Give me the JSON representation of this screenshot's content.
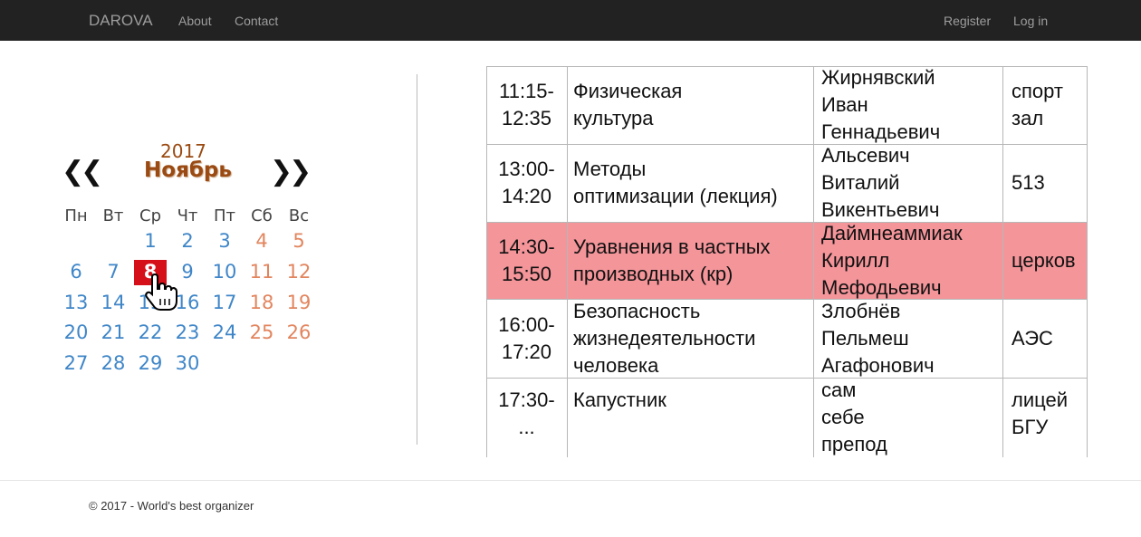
{
  "navbar": {
    "brand": "DAROVA",
    "links": [
      "About",
      "Contact"
    ],
    "right_links": [
      "Register",
      "Log in"
    ]
  },
  "calendar": {
    "year": "2017",
    "month": "Ноябрь",
    "prev_label": "❮❮",
    "next_label": "❯❯",
    "weekdays": [
      "Пн",
      "Вт",
      "Ср",
      "Чт",
      "Пт",
      "Сб",
      "Вс"
    ],
    "weeks": [
      [
        "",
        "",
        "1",
        "2",
        "3",
        "4",
        "5"
      ],
      [
        "6",
        "7",
        "8",
        "9",
        "10",
        "11",
        "12"
      ],
      [
        "13",
        "14",
        "15",
        "16",
        "17",
        "18",
        "19"
      ],
      [
        "20",
        "21",
        "22",
        "23",
        "24",
        "25",
        "26"
      ],
      [
        "27",
        "28",
        "29",
        "30",
        "",
        "",
        ""
      ]
    ],
    "selected_day": "8",
    "colors": {
      "weekday": "#3f86c8",
      "weekend": "#e2855e",
      "selected_bg": "#d61018",
      "header": "#9a4a12"
    }
  },
  "schedule": {
    "highlight_color": "#f4959a",
    "rows": [
      {
        "time": [
          "11:15-",
          "12:35"
        ],
        "subject": [
          "Физическая",
          "культура"
        ],
        "teacher": [
          "Жирнявский",
          "Иван",
          "Геннадьевич"
        ],
        "room": [
          "спорт",
          "зал"
        ],
        "highlight": false
      },
      {
        "time": [
          "13:00-",
          "14:20"
        ],
        "subject": [
          "Методы",
          "оптимизации (лекция)"
        ],
        "teacher": [
          "Альсевич",
          "Виталий",
          "Викентьевич"
        ],
        "room": [
          "513"
        ],
        "highlight": false
      },
      {
        "time": [
          "14:30-",
          "15:50"
        ],
        "subject": [
          "Уравнения в частных",
          "производных (кр)"
        ],
        "teacher": [
          "Даймнеаммиак",
          "Кирилл",
          "Мефодьевич"
        ],
        "room": [
          "церков"
        ],
        "highlight": true
      },
      {
        "time": [
          "16:00-",
          "17:20"
        ],
        "subject": [
          "Безопасность",
          "жизнедеятельности",
          "человека"
        ],
        "teacher": [
          "Злобнёв",
          "Пельмеш",
          "Агафонович"
        ],
        "room": [
          "АЭС"
        ],
        "highlight": false
      },
      {
        "time": [
          "17:30-",
          "..."
        ],
        "subject": [
          "Капустник"
        ],
        "teacher": [
          "сам",
          "себе",
          "препод"
        ],
        "room": [
          "лицей",
          "БГУ"
        ],
        "highlight": false
      }
    ]
  },
  "footer": {
    "text": "© 2017 - World's best organizer"
  }
}
